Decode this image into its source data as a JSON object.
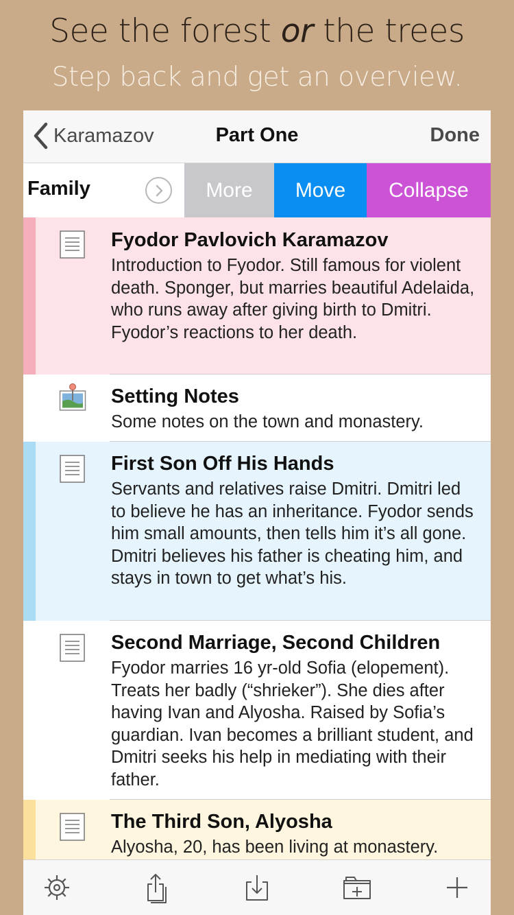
{
  "promo": {
    "headline_before": "See the forest ",
    "headline_italic": "or",
    "headline_after": " the trees",
    "subhead": "Step back and get an overview."
  },
  "navbar": {
    "back_label": "Karamazov",
    "title": "Part One",
    "done_label": "Done"
  },
  "swipe_row": {
    "label": "Family",
    "actions": {
      "more": "More",
      "move": "Move",
      "collapse": "Collapse"
    },
    "colors": {
      "more": "#c7c7cc",
      "move": "#0a8ef2",
      "collapse": "#cc52d6"
    }
  },
  "rows": [
    {
      "icon": "document-icon",
      "color": "pink",
      "title": "Fyodor Pavlovich  Karamazov",
      "body": "Introduction to Fyodor. Still famous for violent death. Sponger, but marries beautiful Adelaida, who runs away after giving birth to Dmitri. Fyodor’s reactions to her death."
    },
    {
      "icon": "image-note-icon",
      "color": "none",
      "title": "Setting Notes",
      "body": "Some notes on the town and monastery."
    },
    {
      "icon": "document-icon",
      "color": "blue",
      "title": "First Son Off His Hands",
      "body": "Servants and relatives raise Dmitri. Dmitri led to believe he has an inheritance. Fyodor sends him small amounts, then tells him it’s all gone. Dmitri believes his father is cheating him, and stays in town to get what’s his."
    },
    {
      "icon": "document-icon",
      "color": "none",
      "title": "Second Marriage, Second Children",
      "body": "Fyodor marries 16 yr-old Sofia (elopement). Treats her badly (“shrieker”). She dies after having Ivan and Alyosha. Raised by Sofia’s guardian. Ivan becomes a brilliant student, and Dmitri seeks his help in mediating with their father."
    },
    {
      "icon": "document-icon",
      "color": "yellow",
      "title": "The Third Son, Alyosha",
      "body": "Alyosha, 20, has been living at monastery."
    }
  ],
  "toolbar": {
    "items": [
      "settings-gear-icon",
      "share-icon",
      "import-icon",
      "add-folder-icon",
      "add-icon"
    ]
  },
  "colors": {
    "background": "#c9ab89",
    "pink_label": "#f7aebb",
    "blue_label": "#abdcf6",
    "yellow_label": "#fbdf9d"
  }
}
